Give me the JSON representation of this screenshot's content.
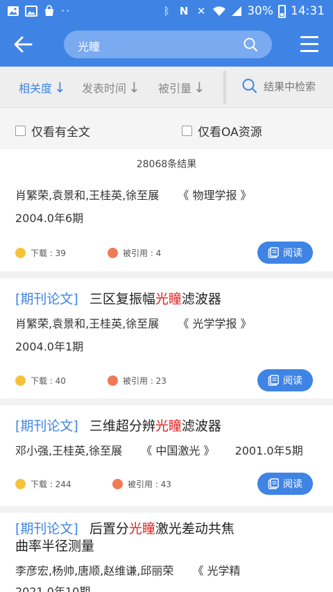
{
  "status_bar": {
    "time": "14:31",
    "battery": "30%",
    "left_icons": [
      "image-icon",
      "gallery-icon",
      "bag-icon"
    ],
    "dots": "··"
  },
  "header": {
    "search_query": "光瞳"
  },
  "sort": {
    "relevance": "相关度",
    "publish_time": "发表时间",
    "citations": "被引量",
    "search_within": "结果中检索"
  },
  "filter": {
    "full_text": "仅看有全文",
    "oa": "仅看OA资源"
  },
  "result_count": "28068条结果",
  "results": [
    {
      "type": "",
      "title_pre": "",
      "title_hl": "",
      "title_post": "",
      "authors": "肖繁荣,袁景和,王桂英,徐至展",
      "journal": "《 物理学报 》",
      "year": "2004.0年6期",
      "downloads": "下载 : 39",
      "cited": "被引用 : 4",
      "read": "阅读"
    },
    {
      "type": "[期刊论文]",
      "title_pre": "三区复振幅",
      "title_hl": "光瞳",
      "title_post": "滤波器",
      "authors": "肖繁荣,袁景和,王桂英,徐至展",
      "journal": "《 光学学报 》",
      "year": "2004.0年1期",
      "downloads": "下载 : 40",
      "cited": "被引用 : 23",
      "read": "阅读"
    },
    {
      "type": "[期刊论文]",
      "title_pre": "三维超分辨",
      "title_hl": "光瞳",
      "title_post": "滤波器",
      "authors": "邓小强,王桂英,徐至展",
      "journal": "《 中国激光 》",
      "year": "2001.0年5期",
      "downloads": "下载 : 244",
      "cited": "被引用 : 43",
      "read": "阅读"
    },
    {
      "type": "[期刊论文]",
      "title_pre": "后置分",
      "title_hl": "光瞳",
      "title_post": "激光差动共焦",
      "title_line2": "曲率半径测量",
      "authors": "李彦宏,杨帅,唐顺,赵维谦,邱丽荣",
      "journal": "《 光学精",
      "year": "2021.0年10期"
    }
  ]
}
